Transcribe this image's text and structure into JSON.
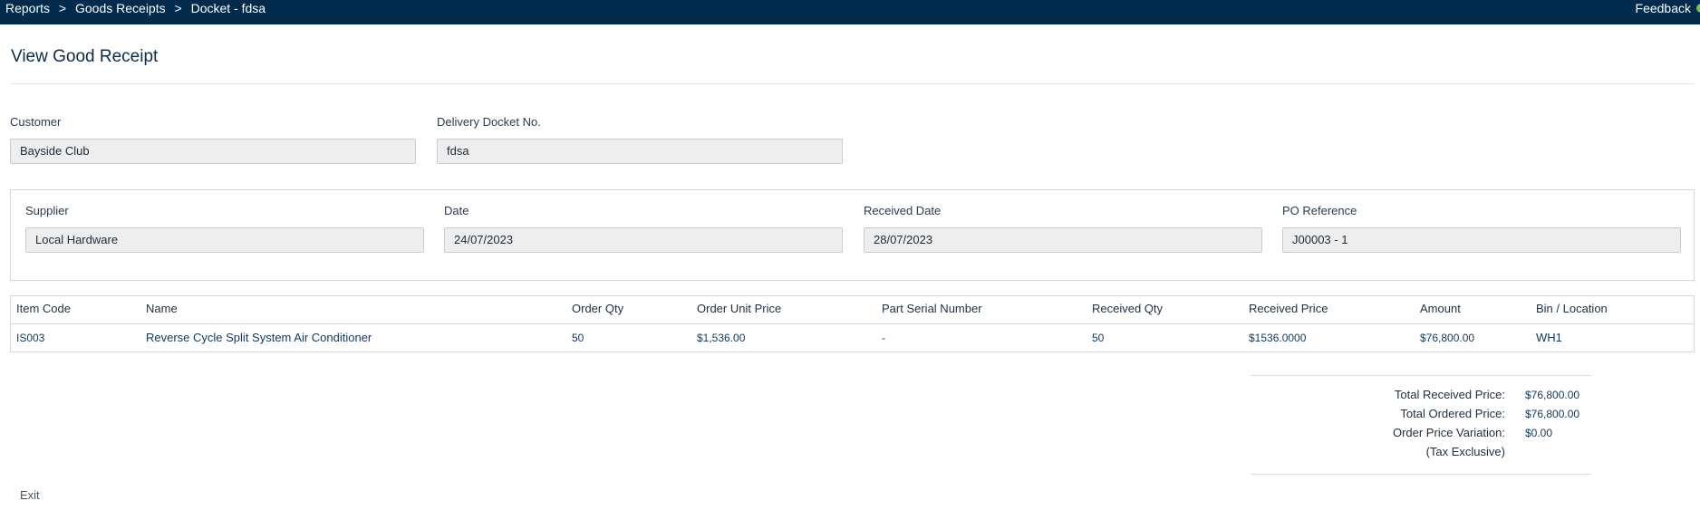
{
  "header": {
    "breadcrumb": [
      "Reports",
      "Goods Receipts",
      "Docket - fdsa"
    ],
    "separator": ">",
    "feedback_label": "Feedback"
  },
  "page": {
    "title": "View Good Receipt"
  },
  "form": {
    "customer_label": "Customer",
    "customer_value": "Bayside Club",
    "docket_label": "Delivery Docket No.",
    "docket_value": "fdsa",
    "supplier_label": "Supplier",
    "supplier_value": "Local Hardware",
    "date_label": "Date",
    "date_value": "24/07/2023",
    "received_date_label": "Received Date",
    "received_date_value": "28/07/2023",
    "po_label": "PO Reference",
    "po_value": "J00003 - 1"
  },
  "table": {
    "columns": [
      "Item Code",
      "Name",
      "Order Qty",
      "Order Unit Price",
      "Part Serial Number",
      "Received Qty",
      "Received Price",
      "Amount",
      "Bin / Location"
    ],
    "rows": [
      [
        "IS003",
        "Reverse Cycle Split System Air Conditioner",
        "50",
        "$1,536.00",
        "-",
        "50",
        "$1536.0000",
        "$76,800.00",
        "WH1"
      ]
    ]
  },
  "totals": {
    "received_label": "Total Received Price:",
    "received_value": "$76,800.00",
    "ordered_label": "Total Ordered Price:",
    "ordered_value": "$76,800.00",
    "variation_label": "Order Price Variation:",
    "variation_value": "$0.00",
    "tax_note": "(Tax Exclusive)"
  },
  "actions": {
    "exit_label": "Exit"
  },
  "colors": {
    "topbar": "#002b4c",
    "feedback_accent": "#7ac143",
    "field_bg": "#eeeeee"
  }
}
